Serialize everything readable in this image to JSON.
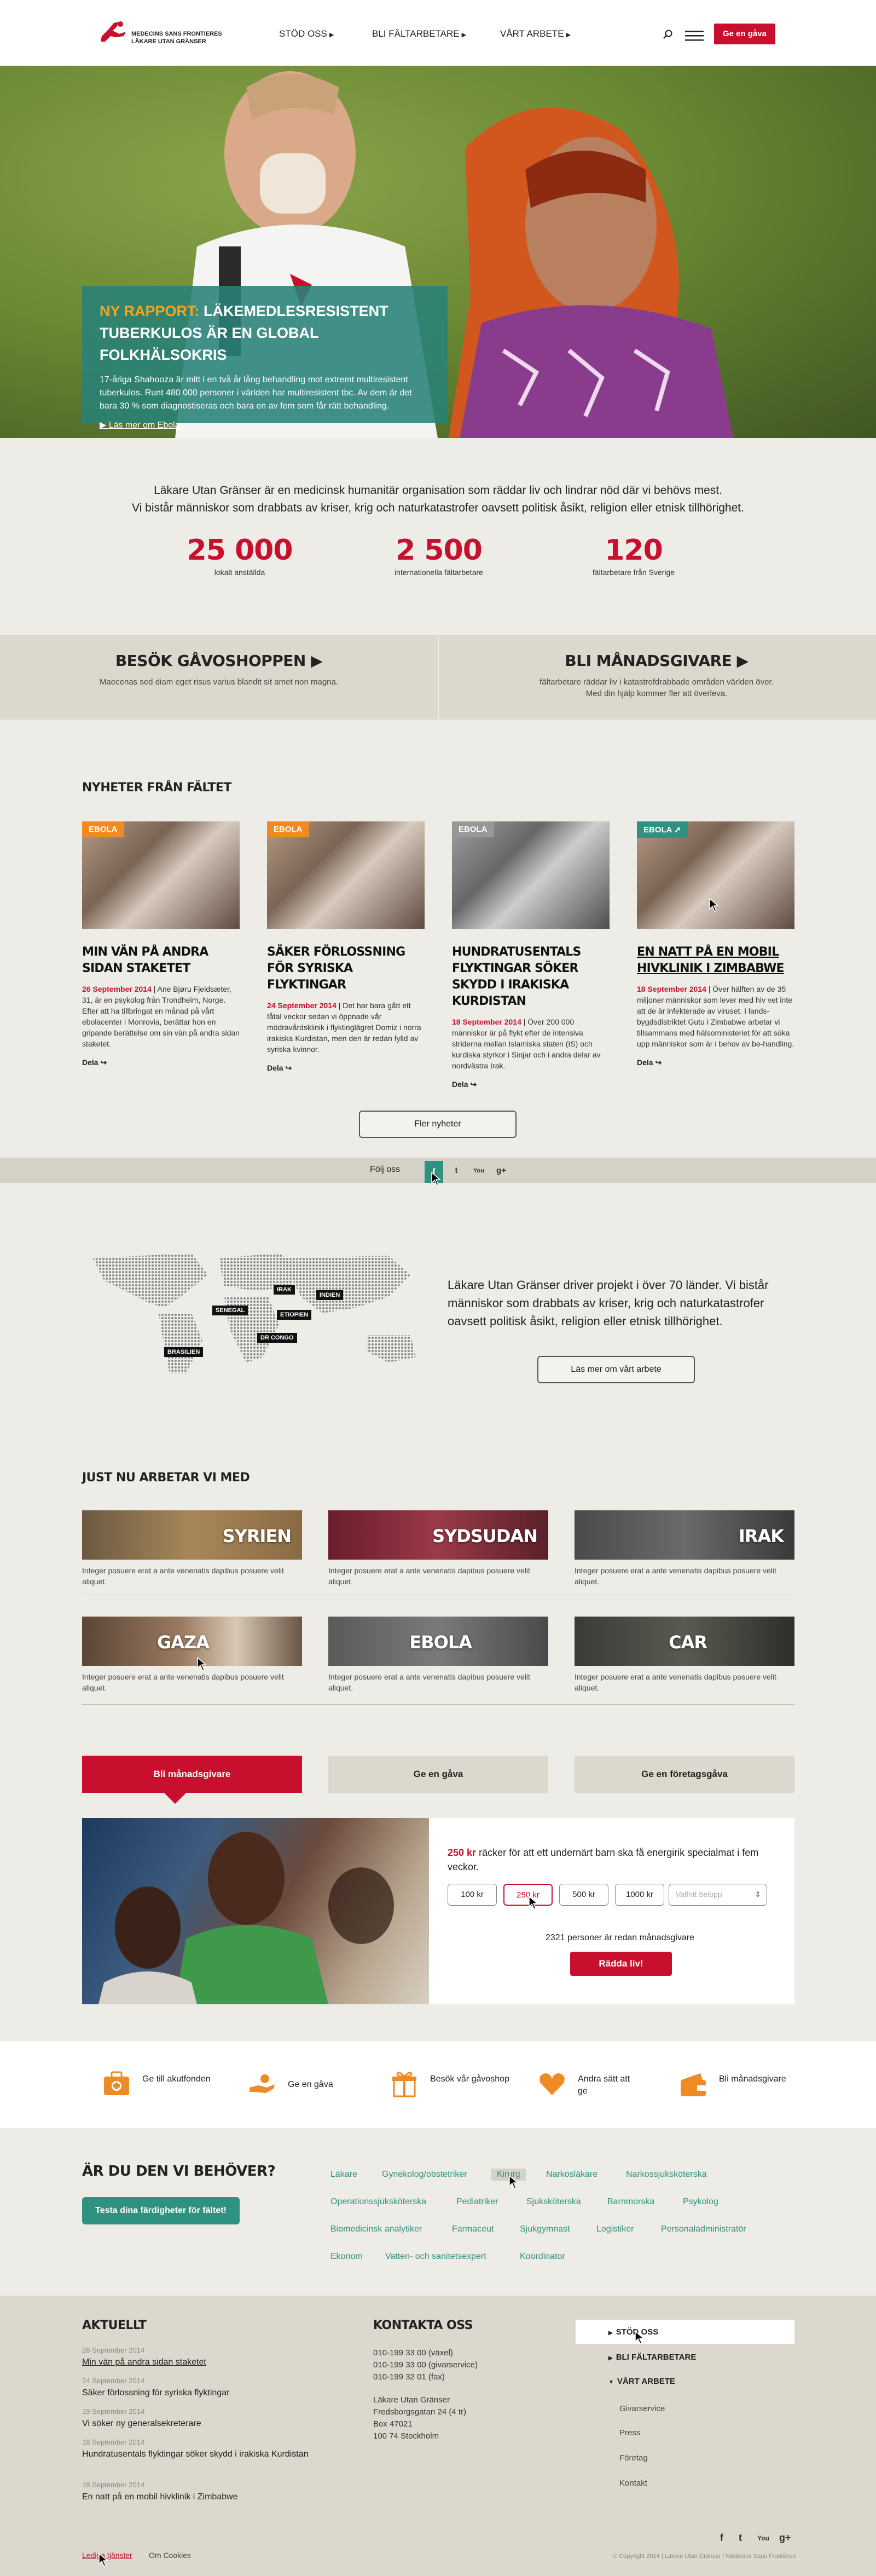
{
  "logo": {
    "line1": "MEDECINS SANS FRONTIERES",
    "line2": "LÄKARE UTAN GRÄNSER"
  },
  "nav": {
    "items": [
      "STÖD OSS",
      "BLI FÄLTARBETARE",
      "VÅRT ARBETE"
    ],
    "donate": "Ge en gåva"
  },
  "hero": {
    "tag": "NY RAPPORT:",
    "title": "LÄKEMEDLESRESISTENT TUBERKULOS ÄR EN GLOBAL FOLKHÄLSOKRIS",
    "text": "17-åriga Shahooza är mitt i en två år lång behandling mot extremt multiresistent tuberkulos. Runt 480 000 personer i världen har multiresistent tbc. Av dem är det bara 30 % som diagnostiseras och bara en av fem som får rätt behandling.",
    "more": "Läs mer om Ebola"
  },
  "mission": {
    "line1": "Läkare Utan Gränser är en medicinsk humanitär organisation som räddar liv och lindrar nöd där vi behövs mest.",
    "line2": "Vi bistår människor som drabbats av kriser, krig och naturkatastrofer oavsett politisk åsikt, religion eller etnisk tillhörighet."
  },
  "stats": [
    {
      "num": "25 000",
      "label": "lokalt anställda"
    },
    {
      "num": "2 500",
      "label": "internationella fältarbetare"
    },
    {
      "num": "120",
      "label": "fältarbetare från Sverige"
    }
  ],
  "cta": [
    {
      "title": "BESÖK GÅVOSHOPPEN",
      "sub": "Maecenas sed diam eget risus varius blandit sit amet non magna."
    },
    {
      "title": "BLI MÅNADSGIVARE",
      "sub1": "fältarbetare räddar liv i katastrofdrabbade områden världen över.",
      "sub2": "Med din hjälp kommer fler att överleva."
    }
  ],
  "news": {
    "heading": "NYHETER FRÅN FÄLTET",
    "cards": [
      {
        "tag": "EBOLA",
        "title": "MIN VÄN PÅ ANDRA SIDAN STAKETET",
        "date": "26 September 2014",
        "body": "| Ane Bjøru Fjeldsæter, 31, är en psykolog från Trondheim, Norge. Efter att ha tillbringat en månad på vårt ebolacenter i Monrovia, berättar hon en gripande berättelse om sin vän på andra sidan staketet.",
        "share": "Dela"
      },
      {
        "tag": "EBOLA",
        "title": "SÄKER FÖRLOSSNING FÖR SYRISKA FLYKTINGAR",
        "date": "24 September 2014",
        "body": "| Det har bara gått ett fåtal veckor sedan vi öppnade vår mödravårdsklinik i flyktinglägret Domiz i norra irakiska Kurdistan, men den är redan fylld av syriska kvinnor.",
        "share": "Dela"
      },
      {
        "tag": "EBOLA",
        "title": "HUNDRATUSENTALS FLYKTINGAR SÖKER SKYDD I IRAKISKA KURDISTAN",
        "date": "18 September 2014",
        "body": "| Över 200 000 människor är på flykt efter de intensiva striderna mellan Islamiska staten (IS) och kurdiska styrkor i Sinjar och i andra delar av nordvästra Irak.",
        "share": "Dela"
      },
      {
        "tag": "EBOLA",
        "title": "EN NATT PÅ EN MOBIL HIVKLINIK I ZIMBABWE",
        "date": "18 September 2014",
        "body": "| Över hälften av de 35 miljoner människor som lever med hiv vet inte att de är infekterade av viruset. I lands-bygdsdistriktet Gutu i Zimbabwe arbetar vi tillsammans med hälsoministeriet för att söka upp människor som är i behov av be-handling.",
        "share": "Dela"
      }
    ],
    "more": "Fler nyheter"
  },
  "follow": {
    "label": "Följ oss",
    "icons": [
      "f",
      "t",
      "You",
      "g+"
    ]
  },
  "map": {
    "pins": [
      "IRAK",
      "INDIEN",
      "SENEGAL",
      "ETIOPIEN",
      "DR CONGO",
      "BRASILIEN"
    ],
    "text": "Läkare Utan Gränser driver projekt i över 70 länder. Vi bistår människor som drabbats av kriser, krig och naturkatastrofer oavsett politisk åsikt, religion eller etnisk tillhörighet.",
    "button": "Läs mer om vårt arbete"
  },
  "projects": {
    "heading": "JUST NU ARBETAR VI MED",
    "items": [
      {
        "name": "SYRIEN",
        "desc": "Integer posuere erat a ante venenatis dapibus posuere velit aliquet."
      },
      {
        "name": "SYDSUDAN",
        "desc": "Integer posuere erat a ante venenatis dapibus posuere velit aliquet."
      },
      {
        "name": "IRAK",
        "desc": "Integer posuere erat a ante venenatis dapibus posuere velit aliquet."
      },
      {
        "name": "GAZA",
        "desc": "Integer posuere erat a ante venenatis dapibus posuere velit aliquet."
      },
      {
        "name": "EBOLA",
        "desc": "Integer posuere erat a ante venenatis dapibus posuere velit aliquet."
      },
      {
        "name": "CAR",
        "desc": "Integer posuere erat a ante venenatis dapibus posuere velit aliquet."
      }
    ]
  },
  "donation": {
    "tabs": [
      "Bli månadsgivare",
      "Ge en gåva",
      "Ge en företagsgåva"
    ],
    "lead_amount": "250 kr",
    "lead_text": "räcker för att ett undernärt barn ska få energirik specialmat i fem veckor.",
    "amounts": [
      "100 kr",
      "250 kr",
      "500 kr",
      "1000 kr"
    ],
    "other_placeholder": "Valfritt belopp",
    "count": "2321 personer är redan månadsgivare",
    "button": "Rädda liv!"
  },
  "iconstrip": [
    {
      "icon": "first-aid-kit-icon",
      "text": "Ge till akutfonden"
    },
    {
      "icon": "giving-hand-icon",
      "text": "Ge en gåva"
    },
    {
      "icon": "gift-icon",
      "text": "Besök vår gåvoshop"
    },
    {
      "icon": "heart-icon",
      "text": "Andra sätt att ge"
    },
    {
      "icon": "wallet-icon",
      "text": "Bli månadsgivare"
    }
  ],
  "careers": {
    "heading": "ÄR DU DEN VI BEHÖVER?",
    "button": "Testa dina färdigheter för fältet!",
    "jobs": [
      [
        "Läkare",
        "Gynekolog/obstetriker",
        "Kirurg",
        "Narkosläkare",
        "Narkossjuksköterska"
      ],
      [
        "Operationssjuksköterska",
        "Pediatriker",
        "Sjuksköterska",
        "Barnmorska",
        "Psykolog"
      ],
      [
        "Biomedicinsk analytiker",
        "Farmaceut",
        "Sjukgymnast",
        "Logistiker",
        "Personaladministratör"
      ],
      [
        "Ekonom",
        "Vatten- och sanitetsexpert",
        "Koordinator"
      ]
    ]
  },
  "footer": {
    "news_heading": "AKTUELLT",
    "news": [
      {
        "date": "26 September 2014",
        "title": "Min vän på andra sidan staketet"
      },
      {
        "date": "24 September 2014",
        "title": "Säker förlossning för syriska flyktingar"
      },
      {
        "date": "19 September 2014",
        "title": "Vi söker ny generalsekreterare"
      },
      {
        "date": "18 September 2014",
        "title": "Hundratusentals flyktingar söker skydd i irakiska Kurdistan"
      },
      {
        "date": "18 September 2014",
        "title": "En natt på en mobil hivklinik i Zimbabwe"
      }
    ],
    "contact_heading": "KONTAKTA OSS",
    "phones": [
      "010-199 33 00 (växel)",
      "010-199 33 00 (givarservice)",
      "010-199 32 01 (fax)"
    ],
    "address": [
      "Läkare Utan Gränser",
      "Fredsborgsgatan 24 (4 tr)",
      "Box 47021",
      "100 74 Stockholm"
    ],
    "nav": [
      "STÖD OSS",
      "BLI FÄLTARBETARE",
      "VÅRT ARBETE"
    ],
    "subnav": [
      "Givarservice",
      "Press",
      "Företag",
      "Kontakt"
    ],
    "links": [
      "Lediga tjänster",
      "Om Cookies"
    ],
    "social": [
      "f",
      "t",
      "You",
      "g+"
    ],
    "copyright": "© Copyright 2014 | Läkare Utan Gränser / Médecins Sans Frontières"
  },
  "colors": {
    "red": "#c8102e",
    "teal": "#2f9180",
    "orange": "#f08a24",
    "beige": "#eeece6"
  }
}
